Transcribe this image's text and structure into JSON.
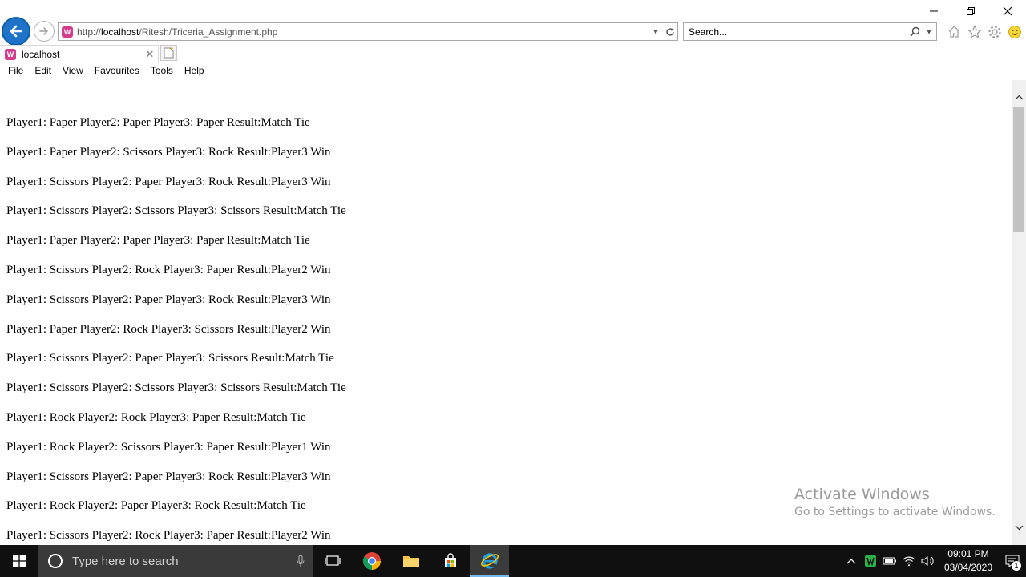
{
  "browser": {
    "url_prefix": "http://",
    "url_host": "localhost",
    "url_path": "/Ritesh/Triceria_Assignment.php",
    "search_placeholder": "Search...",
    "tab_title": "localhost",
    "favicon_letter": "W",
    "menu": [
      "File",
      "Edit",
      "View",
      "Favourites",
      "Tools",
      "Help"
    ],
    "accent": "#1e73c8",
    "favicon_color": "#d43d8c"
  },
  "results": [
    "Player1: Paper Player2: Paper Player3: Paper Result:Match Tie",
    "Player1: Paper Player2: Scissors Player3: Rock Result:Player3 Win",
    "Player1: Scissors Player2: Paper Player3: Rock Result:Player3 Win",
    "Player1: Scissors Player2: Scissors Player3: Scissors Result:Match Tie",
    "Player1: Paper Player2: Paper Player3: Paper Result:Match Tie",
    "Player1: Scissors Player2: Rock Player3: Paper Result:Player2 Win",
    "Player1: Scissors Player2: Paper Player3: Rock Result:Player3 Win",
    "Player1: Paper Player2: Rock Player3: Scissors Result:Player2 Win",
    "Player1: Scissors Player2: Paper Player3: Scissors Result:Match Tie",
    "Player1: Scissors Player2: Scissors Player3: Scissors Result:Match Tie",
    "Player1: Rock Player2: Rock Player3: Paper Result:Match Tie",
    "Player1: Rock Player2: Scissors Player3: Paper Result:Player1 Win",
    "Player1: Scissors Player2: Paper Player3: Rock Result:Player3 Win",
    "Player1: Rock Player2: Paper Player3: Rock Result:Match Tie",
    "Player1: Scissors Player2: Rock Player3: Paper Result:Player2 Win"
  ],
  "watermark": {
    "title": "Activate Windows",
    "subtitle": "Go to Settings to activate Windows."
  },
  "taskbar": {
    "search_placeholder": "Type here to search",
    "time": "09:01 PM",
    "date": "03/04/2020",
    "notification_count": "1"
  }
}
